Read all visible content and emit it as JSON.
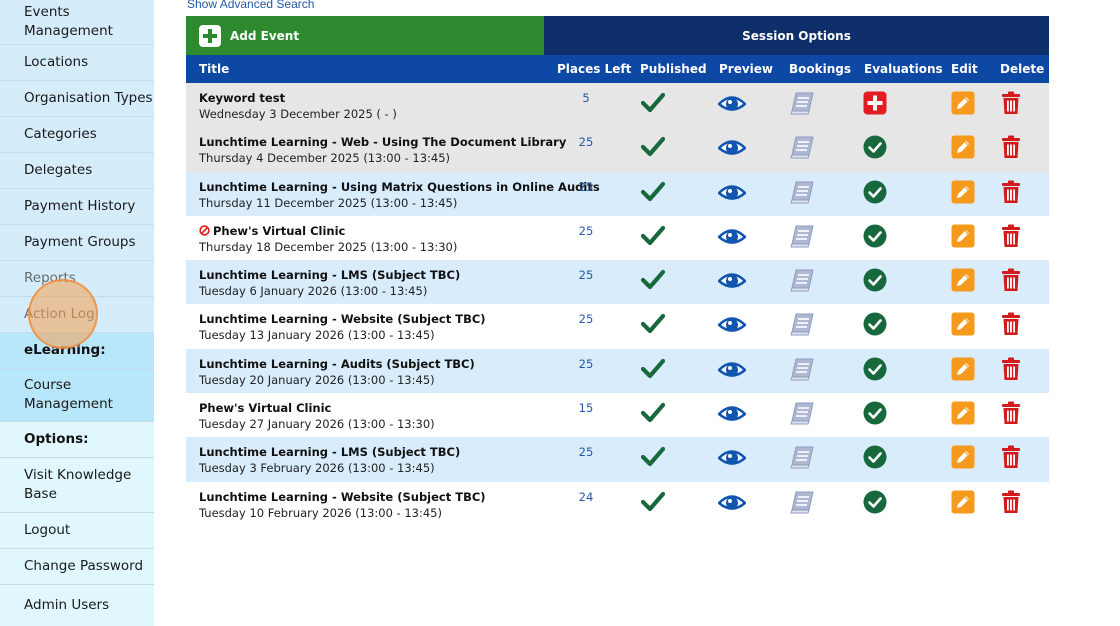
{
  "sidebar": {
    "items": [
      {
        "label": "Events\nManagement"
      },
      {
        "label": "Locations"
      },
      {
        "label": "Organisation Types"
      },
      {
        "label": "Categories"
      },
      {
        "label": "Delegates"
      },
      {
        "label": "Payment History"
      },
      {
        "label": "Payment Groups"
      },
      {
        "label": "Reports"
      },
      {
        "label": "Action Log"
      },
      {
        "label": "eLearning:"
      },
      {
        "label": "Course\nManagement"
      },
      {
        "label": "Options:"
      },
      {
        "label": "Visit Knowledge\nBase"
      },
      {
        "label": "Logout"
      },
      {
        "label": "Change Password"
      },
      {
        "label": "Admin Users"
      }
    ]
  },
  "main": {
    "advanced_search_link": "Show Advanced Search",
    "add_event_label": "Add Event",
    "session_options_label": "Session Options",
    "columns": [
      "Title",
      "Places Left",
      "Published",
      "Preview",
      "Bookings",
      "Evaluations",
      "Edit",
      "Delete"
    ],
    "rows": [
      {
        "title": "Keyword test",
        "date": "Wednesday 3 December 2025 ( - )",
        "places": "5",
        "eval": "add",
        "cancelled": false
      },
      {
        "title": "Lunchtime Learning - Web - Using The Document Library",
        "date": "Thursday 4 December 2025 (13:00 - 13:45)",
        "places": "25",
        "eval": "done",
        "cancelled": false
      },
      {
        "title": "Lunchtime Learning - Using Matrix Questions in Online Audits",
        "date": "Thursday 11 December 2025 (13:00 - 13:45)",
        "places": "25",
        "eval": "done",
        "cancelled": false
      },
      {
        "title": "Phew's Virtual Clinic",
        "date": "Thursday 18 December 2025 (13:00 - 13:30)",
        "places": "25",
        "eval": "done",
        "cancelled": true
      },
      {
        "title": "Lunchtime Learning - LMS (Subject TBC)",
        "date": "Tuesday 6 January 2026 (13:00 - 13:45)",
        "places": "25",
        "eval": "done",
        "cancelled": false
      },
      {
        "title": "Lunchtime Learning - Website (Subject TBC)",
        "date": "Tuesday 13 January 2026 (13:00 - 13:45)",
        "places": "25",
        "eval": "done",
        "cancelled": false
      },
      {
        "title": "Lunchtime Learning - Audits (Subject TBC)",
        "date": "Tuesday 20 January 2026 (13:00 - 13:45)",
        "places": "25",
        "eval": "done",
        "cancelled": false
      },
      {
        "title": "Phew's Virtual Clinic",
        "date": "Tuesday 27 January 2026 (13:00 - 13:30)",
        "places": "15",
        "eval": "done",
        "cancelled": false
      },
      {
        "title": "Lunchtime Learning - LMS (Subject TBC)",
        "date": "Tuesday 3 February 2026 (13:00 - 13:45)",
        "places": "25",
        "eval": "done",
        "cancelled": false
      },
      {
        "title": "Lunchtime Learning - Website (Subject TBC)",
        "date": "Tuesday 10 February 2026 (13:00 - 13:45)",
        "places": "24",
        "eval": "done",
        "cancelled": false
      }
    ]
  },
  "colors": {
    "header_blue": "#0d48a5",
    "session_navy": "#0f2f6b",
    "add_green": "#2e8a2e",
    "check_green": "#17683c",
    "eye_blue": "#1155b0",
    "edit_orange": "#f59a1c",
    "delete_red": "#d31a1a"
  },
  "icons": {
    "published": "check-icon",
    "preview": "eye-icon",
    "bookings": "book-icon",
    "evaluation_done": "check-circle-icon",
    "evaluation_add": "plus-square-icon",
    "edit": "pencil-icon",
    "delete": "trash-icon",
    "cancelled": "cancel-icon"
  }
}
